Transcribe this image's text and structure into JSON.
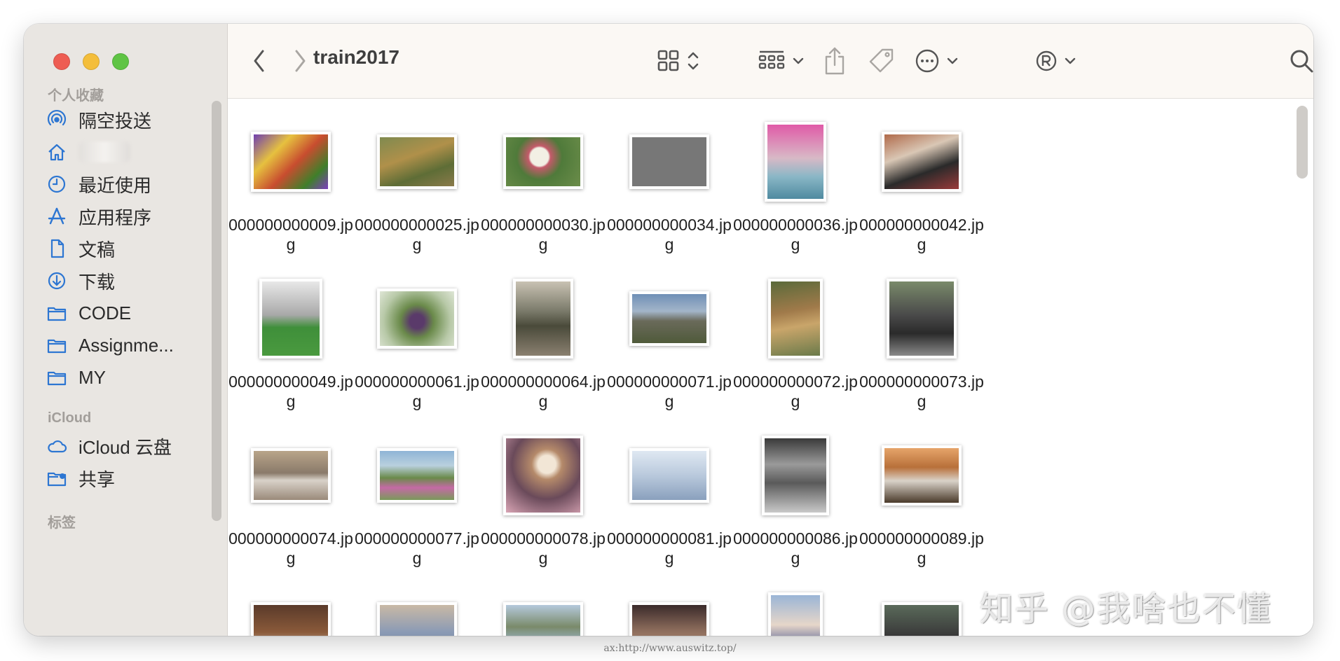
{
  "window": {
    "title": "train2017"
  },
  "sidebar": {
    "favorites_title": "个人收藏",
    "favorites": [
      {
        "label": "隔空投送",
        "icon": "airdrop-icon"
      },
      {
        "label": "",
        "icon": "home-icon"
      },
      {
        "label": "最近使用",
        "icon": "recents-clock-icon"
      },
      {
        "label": "应用程序",
        "icon": "applications-icon"
      },
      {
        "label": "文稿",
        "icon": "document-icon"
      },
      {
        "label": "下载",
        "icon": "downloads-icon"
      },
      {
        "label": "CODE",
        "icon": "folder-icon"
      },
      {
        "label": "Assignme...",
        "icon": "folder-icon"
      },
      {
        "label": "MY",
        "icon": "folder-icon"
      }
    ],
    "icloud_title": "iCloud",
    "icloud": [
      {
        "label": "iCloud 云盘",
        "icon": "cloud-icon"
      },
      {
        "label": "共享",
        "icon": "shared-folder-icon"
      }
    ],
    "tags_title": "标签"
  },
  "files": [
    {
      "name": "000000000009.jpg"
    },
    {
      "name": "000000000025.jpg"
    },
    {
      "name": "000000000030.jpg"
    },
    {
      "name": "000000000034.jpg"
    },
    {
      "name": "000000000036.jpg"
    },
    {
      "name": "000000000042.jpg"
    },
    {
      "name": "000000000049.jpg"
    },
    {
      "name": "000000000061.jpg"
    },
    {
      "name": "000000000064.jpg"
    },
    {
      "name": "000000000071.jpg"
    },
    {
      "name": "000000000072.jpg"
    },
    {
      "name": "000000000073.jpg"
    },
    {
      "name": "000000000074.jpg"
    },
    {
      "name": "000000000077.jpg"
    },
    {
      "name": "000000000078.jpg"
    },
    {
      "name": "000000000081.jpg"
    },
    {
      "name": "000000000086.jpg"
    },
    {
      "name": "000000000089.jpg"
    }
  ],
  "watermark": "知乎 @我啥也不懂",
  "caption": "ax:http://www.auswitz.top/",
  "colors": {
    "accent": "#2d76d2",
    "sidebar_bg": "#e9e6e2",
    "toolbar_bg": "#fbf8f4"
  }
}
